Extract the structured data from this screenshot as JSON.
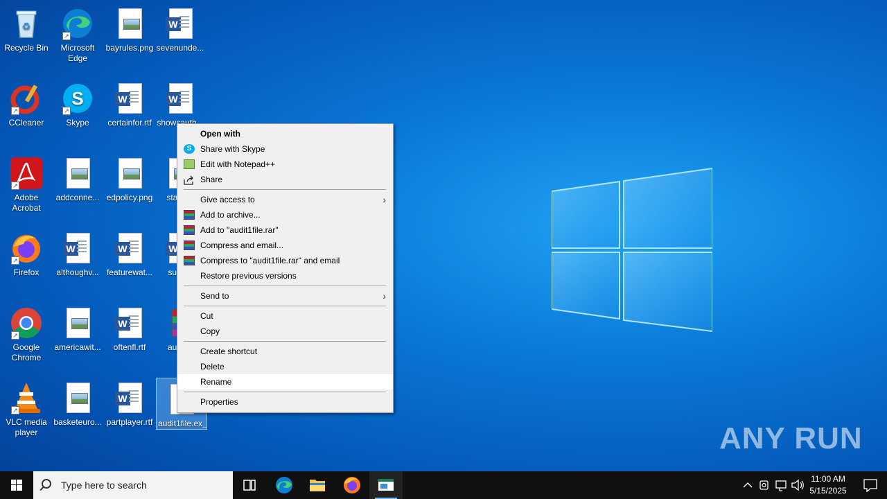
{
  "desktop": {
    "icons": [
      {
        "label": "Recycle Bin",
        "icon": "recycle-bin-icon"
      },
      {
        "label": "Microsoft Edge",
        "icon": "edge-icon"
      },
      {
        "label": "bayrules.png",
        "icon": "image-file-icon"
      },
      {
        "label": "sevenunde...",
        "icon": "word-doc-icon"
      },
      {
        "label": "CCleaner",
        "icon": "ccleaner-icon"
      },
      {
        "label": "Skype",
        "icon": "skype-icon"
      },
      {
        "label": "certainfor.rtf",
        "icon": "word-doc-icon"
      },
      {
        "label": "showsauth...",
        "icon": "word-doc-icon"
      },
      {
        "label": "Adobe Acrobat",
        "icon": "acrobat-icon"
      },
      {
        "label": "addconne...",
        "icon": "image-file-icon"
      },
      {
        "label": "edpolicy.png",
        "icon": "image-file-icon"
      },
      {
        "label": "stand...",
        "icon": "image-file-icon"
      },
      {
        "label": "Firefox",
        "icon": "firefox-icon"
      },
      {
        "label": "althoughv...",
        "icon": "word-doc-icon"
      },
      {
        "label": "featurewat...",
        "icon": "word-doc-icon"
      },
      {
        "label": "subs...",
        "icon": "word-doc-icon"
      },
      {
        "label": "Google Chrome",
        "icon": "chrome-icon"
      },
      {
        "label": "americawit...",
        "icon": "image-file-icon"
      },
      {
        "label": "oftenfl.rtf",
        "icon": "word-doc-icon"
      },
      {
        "label": "audit...",
        "icon": "rar-archive-icon"
      },
      {
        "label": "VLC media player",
        "icon": "vlc-icon"
      },
      {
        "label": "basketeuro...",
        "icon": "image-file-icon"
      },
      {
        "label": "partplayer.rtf",
        "icon": "word-doc-icon"
      },
      {
        "label": "audit1file.ex_",
        "icon": "blank-file-icon"
      }
    ]
  },
  "context_menu": {
    "open_with": "Open with",
    "share_skype": "Share with Skype",
    "edit_notepad": "Edit with Notepad++",
    "share": "Share",
    "give_access": "Give access to",
    "add_archive": "Add to archive...",
    "add_rar": "Add to \"audit1file.rar\"",
    "compress_email": "Compress and email...",
    "compress_rar_email": "Compress to \"audit1file.rar\" and email",
    "restore": "Restore previous versions",
    "send_to": "Send to",
    "cut": "Cut",
    "copy": "Copy",
    "create_shortcut": "Create shortcut",
    "delete": "Delete",
    "rename": "Rename",
    "properties": "Properties",
    "highlighted": "Rename"
  },
  "taskbar": {
    "search_placeholder": "Type here to search",
    "time": "11:00 AM",
    "date": "5/15/2025"
  },
  "watermark": "ANY RUN"
}
